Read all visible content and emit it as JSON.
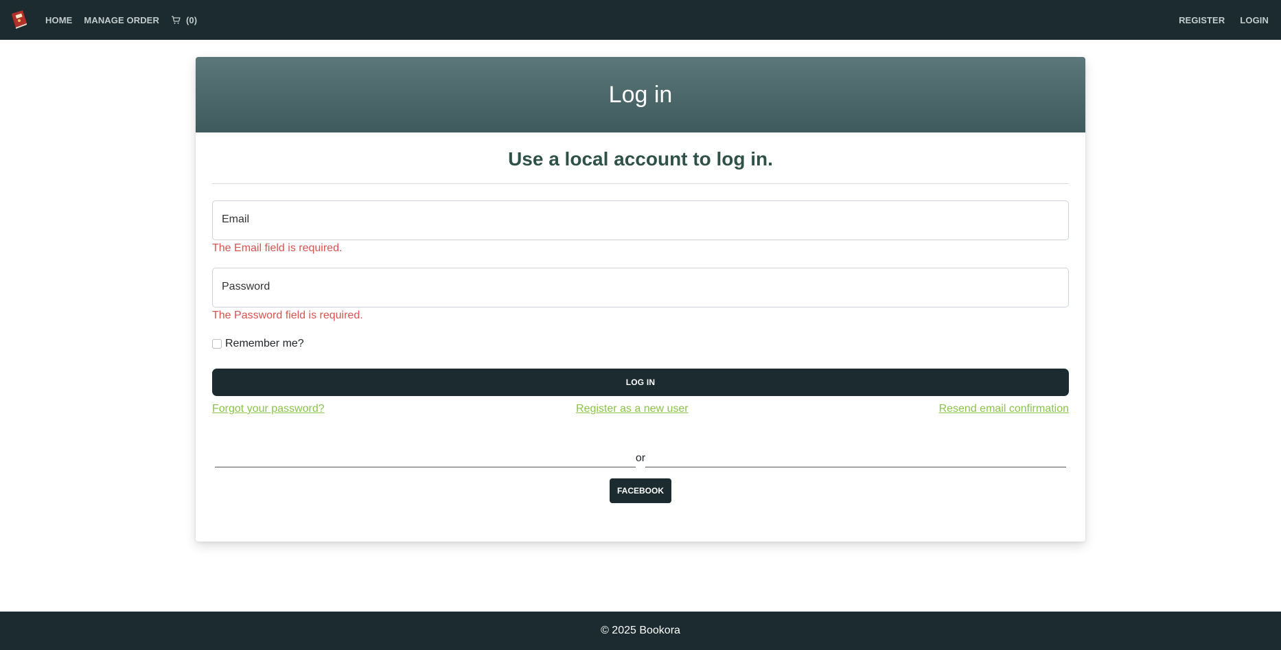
{
  "nav": {
    "logo_icon": "book-icon",
    "home_label": "HOME",
    "manage_order_label": "MANAGE ORDER",
    "cart_icon": "cart-icon",
    "cart_count": "(0)",
    "register_label": "REGISTER",
    "login_label": "LOGIN"
  },
  "card": {
    "title": "Log in",
    "subtitle": "Use a local account to log in.",
    "email_label": "Email",
    "email_error": "The Email field is required.",
    "password_label": "Password",
    "password_error": "The Password field is required.",
    "remember_label": "Remember me?",
    "login_button": "LOG IN",
    "forgot_link": "Forgot your password?",
    "register_link": "Register as a new user",
    "resend_link": "Resend email confirmation",
    "or_text": "or",
    "facebook_button": "FACEBOOK"
  },
  "footer": {
    "text": "© 2025 Bookora"
  },
  "colors": {
    "nav_bg": "#1b2b2f",
    "header_gradient_top": "#5b7779",
    "header_gradient_bottom": "#3f5a5c",
    "error": "#d9534f",
    "link": "#8bc34a",
    "subtitle": "#2f5147"
  }
}
